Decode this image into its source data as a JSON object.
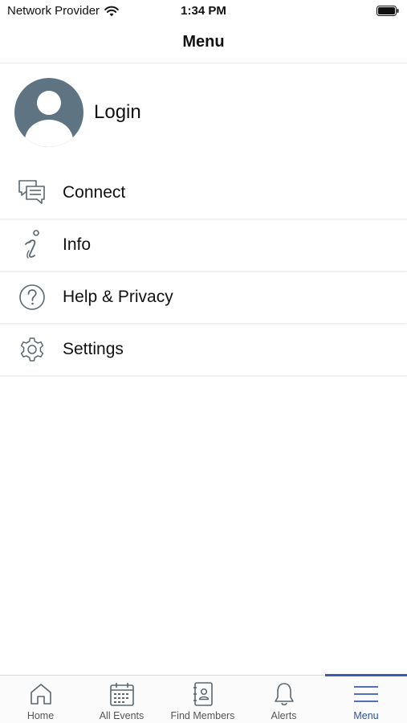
{
  "status_bar": {
    "carrier": "Network Provider",
    "time": "1:34 PM"
  },
  "nav": {
    "title": "Menu"
  },
  "login": {
    "label": "Login",
    "icon": "avatar-icon"
  },
  "menu": {
    "items": [
      {
        "label": "Connect",
        "icon": "chat-icon"
      },
      {
        "label": "Info",
        "icon": "info-icon"
      },
      {
        "label": "Help & Privacy",
        "icon": "help-icon"
      },
      {
        "label": "Settings",
        "icon": "gear-icon"
      }
    ]
  },
  "tab_bar": {
    "tabs": [
      {
        "label": "Home",
        "icon": "home-icon"
      },
      {
        "label": "All Events",
        "icon": "calendar-icon"
      },
      {
        "label": "Find Members",
        "icon": "address-book-icon"
      },
      {
        "label": "Alerts",
        "icon": "bell-icon"
      },
      {
        "label": "Menu",
        "icon": "hamburger-icon"
      }
    ],
    "active_index": 4
  },
  "colors": {
    "accent": "#3a5bb0",
    "avatar": "#5f7482",
    "icon_stroke": "#5b6770"
  }
}
